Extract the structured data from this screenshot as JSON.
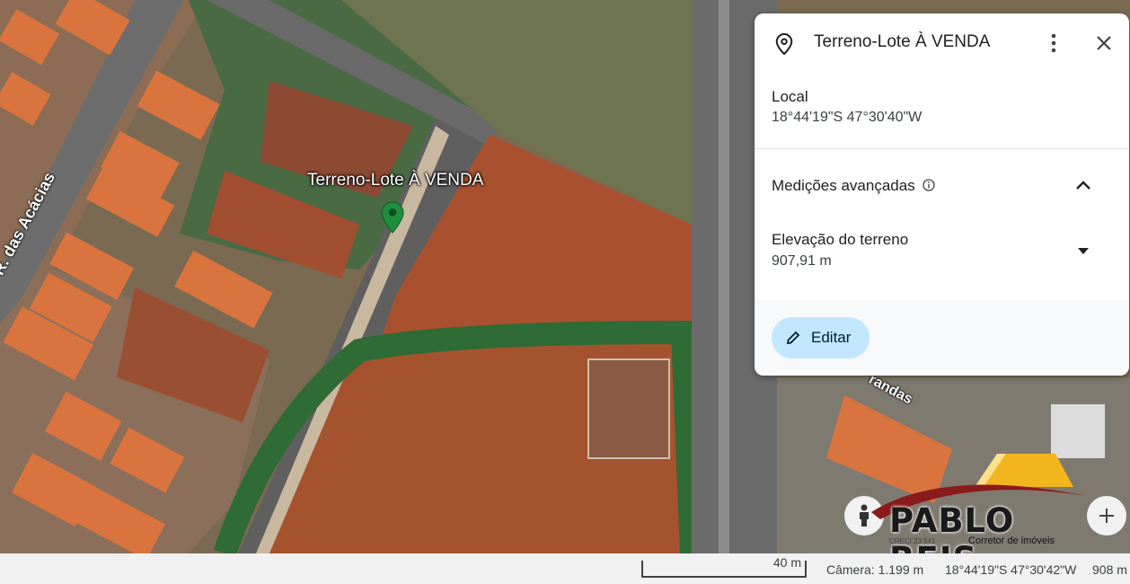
{
  "map": {
    "street_labels": [
      "R. das Acácias",
      "randas"
    ],
    "pin_label": "Terreno-Lote À VENDA"
  },
  "panel": {
    "title": "Terreno-Lote À VENDA",
    "local_label": "Local",
    "local_value": "18°44'19\"S 47°30'40\"W",
    "advanced_label": "Medições avançadas",
    "elevation_label": "Elevação do terreno",
    "elevation_value": "907,91 m",
    "edit_label": "Editar"
  },
  "status_bar": {
    "scale": "40 m",
    "camera": "Câmera: 1.199 m",
    "coords": "18°44'19\"S 47°30'42\"W",
    "altitude": "908 m"
  },
  "watermark": {
    "name": "PABLO REIS",
    "subtitle": "Corretor de imóveis",
    "creci": "CRECI 23.541"
  },
  "colors": {
    "accent_button": "#c2e7ff",
    "pin": "#1e8e3e",
    "soil": "#a5532e"
  }
}
